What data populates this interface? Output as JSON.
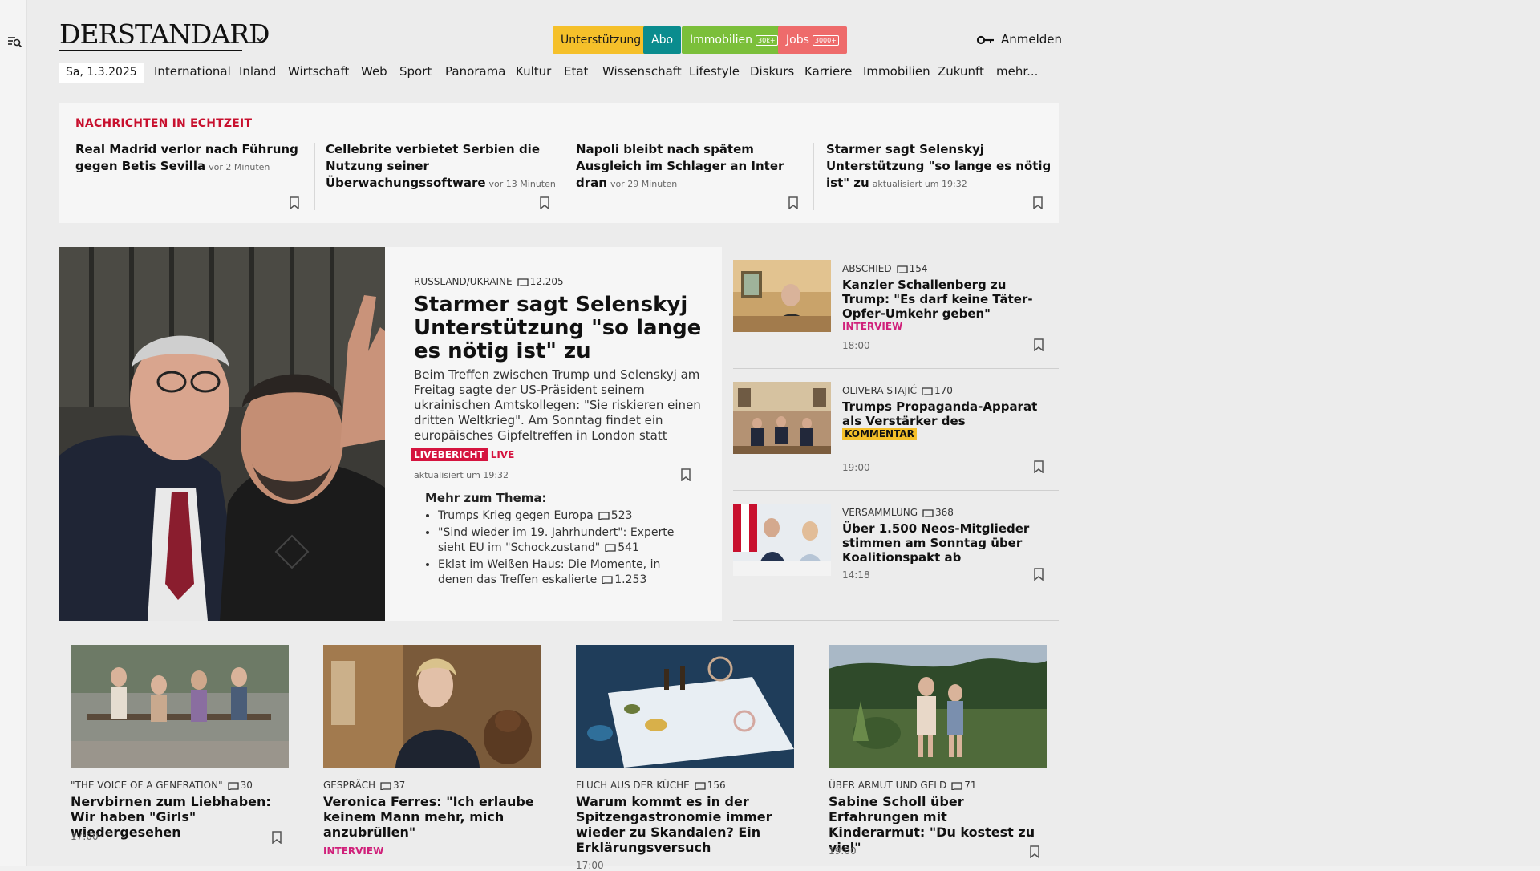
{
  "header": {
    "logo": "DERSTANDARD",
    "buttons": [
      {
        "label": "Unterstützung",
        "bg": "#f5c02a",
        "fg": "#1a1a1a"
      },
      {
        "label": "Abo",
        "bg": "#0a8c8e",
        "fg": "#ffffff"
      },
      {
        "label": "Immobilien",
        "badge": "30k+",
        "bg": "#7bbf3a",
        "fg": "#ffffff"
      },
      {
        "label": "Jobs",
        "badge": "3000+",
        "bg": "#ee6b6b",
        "fg": "#ffffff"
      }
    ],
    "login_label": "Anmelden"
  },
  "nav": {
    "date": "Sa, 1.3.2025",
    "items": [
      "International",
      "Inland",
      "Wirtschaft",
      "Web",
      "Sport",
      "Panorama",
      "Kultur",
      "Etat",
      "Wissenschaft",
      "Lifestyle",
      "Diskurs",
      "Karriere",
      "Immobilien",
      "Zukunft",
      "mehr..."
    ]
  },
  "realtime": {
    "title": "NACHRICHTEN IN ECHTZEIT",
    "items": [
      {
        "headline": "Real Madrid verlor nach Führung gegen Betis Sevilla",
        "time": "vor 2 Minuten"
      },
      {
        "headline": "Cellebrite verbietet Serbien die Nutzung seiner Überwachungssoftware",
        "time": "vor 13 Minuten"
      },
      {
        "headline": "Napoli bleibt nach spätem Ausgleich im Schlager an Inter dran",
        "time": "vor 29 Minuten"
      },
      {
        "headline": "Starmer sagt Selenskyj Unterstützung \"so lange es nötig ist\" zu",
        "time": "aktualisiert um 19:32"
      }
    ]
  },
  "lead": {
    "kicker": "RUSSLAND/UKRAINE",
    "comments": "12.205",
    "title": "Starmer sagt Selenskyj Unterstützung \"so lange es nötig ist\" zu",
    "teaser": "Beim Treffen zwischen Trump und Selenskyj am Freitag sagte der US-Präsident seinem ukrainischen Amtskollegen: \"Sie riskieren einen dritten Weltkrieg\". Am Sonntag findet ein europäisches Gipfeltreffen in London statt",
    "badge_box": "LIVEBERICHT",
    "badge_live": "LIVE",
    "updated": "aktualisiert um 19:32",
    "more_title": "Mehr zum Thema:",
    "more": [
      {
        "text": "Trumps Krieg gegen Europa",
        "comments": "523"
      },
      {
        "text": "\"Sind wieder im 19. Jahrhundert\": Experte sieht EU im \"Schockzustand\"",
        "comments": "541"
      },
      {
        "text": "Eklat im Weißen Haus: Die Momente, in denen das Treffen eskalierte",
        "comments": "1.253"
      }
    ]
  },
  "side": [
    {
      "kicker": "ABSCHIED",
      "comments": "154",
      "title": "Kanzler Schallenberg zu Trump: \"Es darf keine Täter-Opfer-Umkehr geben\"",
      "label": "INTERVIEW",
      "label_color": "#d0207a",
      "time": "18:00"
    },
    {
      "kicker": "OLIVERA STAJIĆ",
      "comments": "170",
      "title": "Trumps Propaganda-Apparat als Verstärker des Wahnsinns",
      "label": "KOMMENTAR",
      "label_color": "#f5c02a",
      "time": "19:00"
    },
    {
      "kicker": "VERSAMMLUNG",
      "comments": "368",
      "title": "Über 1.500 Neos-Mitglieder stimmen am Sonntag über Koalitionspakt ab",
      "label": "",
      "time": "14:18"
    }
  ],
  "cards": [
    {
      "kicker": "\"THE VOICE OF A GENERATION\"",
      "comments": "30",
      "title": "Nervbirnen zum Liebhaben: Wir haben \"Girls\" wiedergesehen",
      "label": "",
      "time": "17:00"
    },
    {
      "kicker": "GESPRÄCH",
      "comments": "37",
      "title": "Veronica Ferres: \"Ich erlaube keinem Mann mehr, mich anzubrüllen\"",
      "label": "INTERVIEW",
      "time": ""
    },
    {
      "kicker": "FLUCH AUS DER KÜCHE",
      "comments": "156",
      "title": "Warum kommt es in der Spitzengastronomie immer wieder zu Skandalen? Ein Erklärungsversuch",
      "label": "",
      "time": "17:00"
    },
    {
      "kicker": "ÜBER ARMUT UND GELD",
      "comments": "71",
      "title": "Sabine Scholl über Erfahrungen mit Kinderarmut: \"Du kostest zu viel\"",
      "label": "",
      "time": "19:00"
    }
  ]
}
